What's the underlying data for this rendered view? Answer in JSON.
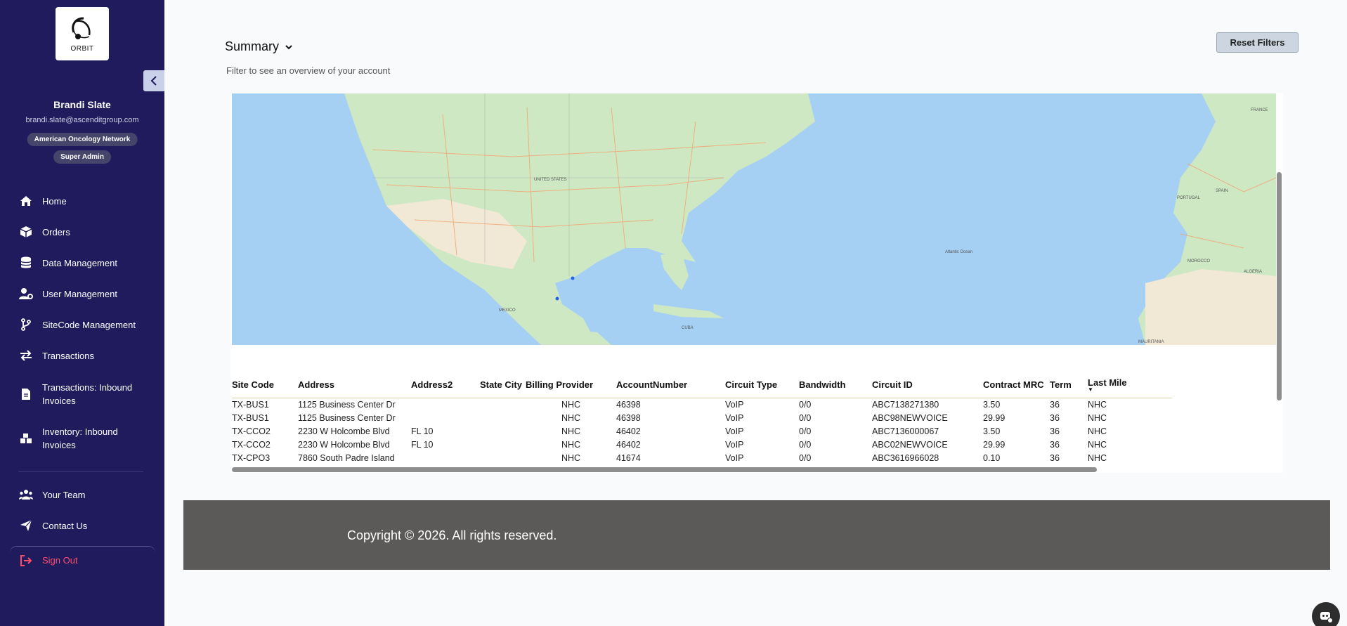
{
  "sidebar": {
    "logo_text": "ORBIT",
    "user": {
      "name": "Brandi Slate",
      "email": "brandi.slate@ascenditgroup.com",
      "organization": "American Oncology Network",
      "role": "Super Admin"
    },
    "items": [
      {
        "label": "Home",
        "icon": "home-icon"
      },
      {
        "label": "Orders",
        "icon": "box-icon"
      },
      {
        "label": "Data Management",
        "icon": "database-icon"
      },
      {
        "label": "User Management",
        "icon": "user-gear-icon"
      },
      {
        "label": "SiteCode Management",
        "icon": "branch-icon"
      },
      {
        "label": "Transactions",
        "icon": "swap-icon"
      },
      {
        "label": "Transactions: Inbound Invoices",
        "icon": "file-icon"
      },
      {
        "label": "Inventory: Inbound Invoices",
        "icon": "boxes-icon"
      }
    ],
    "bottom_items": [
      {
        "label": "Your Team",
        "icon": "team-icon"
      },
      {
        "label": "Contact Us",
        "icon": "send-icon"
      }
    ],
    "sign_out": "Sign Out"
  },
  "main": {
    "title": "Summary",
    "subtitle": "Filter to see an overview of your account",
    "reset_filters": "Reset Filters"
  },
  "table": {
    "headers": [
      "Site Code",
      "Address",
      "Address2",
      "State",
      "City",
      "Billing Provider",
      "AccountNumber",
      "Circuit Type",
      "Bandwidth",
      "Circuit ID",
      "Contract MRC",
      "Term",
      "Last Mile"
    ],
    "rows": [
      [
        "TX-BUS1",
        "1125 Business Center Dr",
        "",
        "",
        "",
        "NHC",
        "46398",
        "VoIP",
        "0/0",
        "ABC7138271380",
        "3.50",
        "36",
        "NHC"
      ],
      [
        "TX-BUS1",
        "1125 Business Center Dr",
        "",
        "",
        "",
        "NHC",
        "46398",
        "VoIP",
        "0/0",
        "ABC98NEWVOICE",
        "29.99",
        "36",
        "NHC"
      ],
      [
        "TX-CCO2",
        "2230 W Holcombe Blvd",
        "FL 10",
        "",
        "",
        "NHC",
        "46402",
        "VoIP",
        "0/0",
        "ABC7136000067",
        "3.50",
        "36",
        "NHC"
      ],
      [
        "TX-CCO2",
        "2230 W Holcombe Blvd",
        "FL 10",
        "",
        "",
        "NHC",
        "46402",
        "VoIP",
        "0/0",
        "ABC02NEWVOICE",
        "29.99",
        "36",
        "NHC"
      ],
      [
        "TX-CPO3",
        "7860 South Padre Island",
        "",
        "",
        "",
        "NHC",
        "41674",
        "VoIP",
        "0/0",
        "ABC3616966028",
        "0.10",
        "36",
        "NHC"
      ]
    ]
  },
  "map": {
    "labels": [
      "UNITED STATES",
      "MEXICO",
      "CUBA",
      "ALGERIA",
      "MOROCCO",
      "FRANCE",
      "PORTUGAL",
      "SPAIN",
      "Atlantic Ocean",
      "MAURITANIA"
    ],
    "colors": {
      "water": "#a6d0f3",
      "land": "#cfe8c4",
      "desert": "#f1e8d6",
      "roads": "#f2a36b"
    }
  },
  "footer": {
    "text": "Copyright © 2026. All rights reserved."
  }
}
